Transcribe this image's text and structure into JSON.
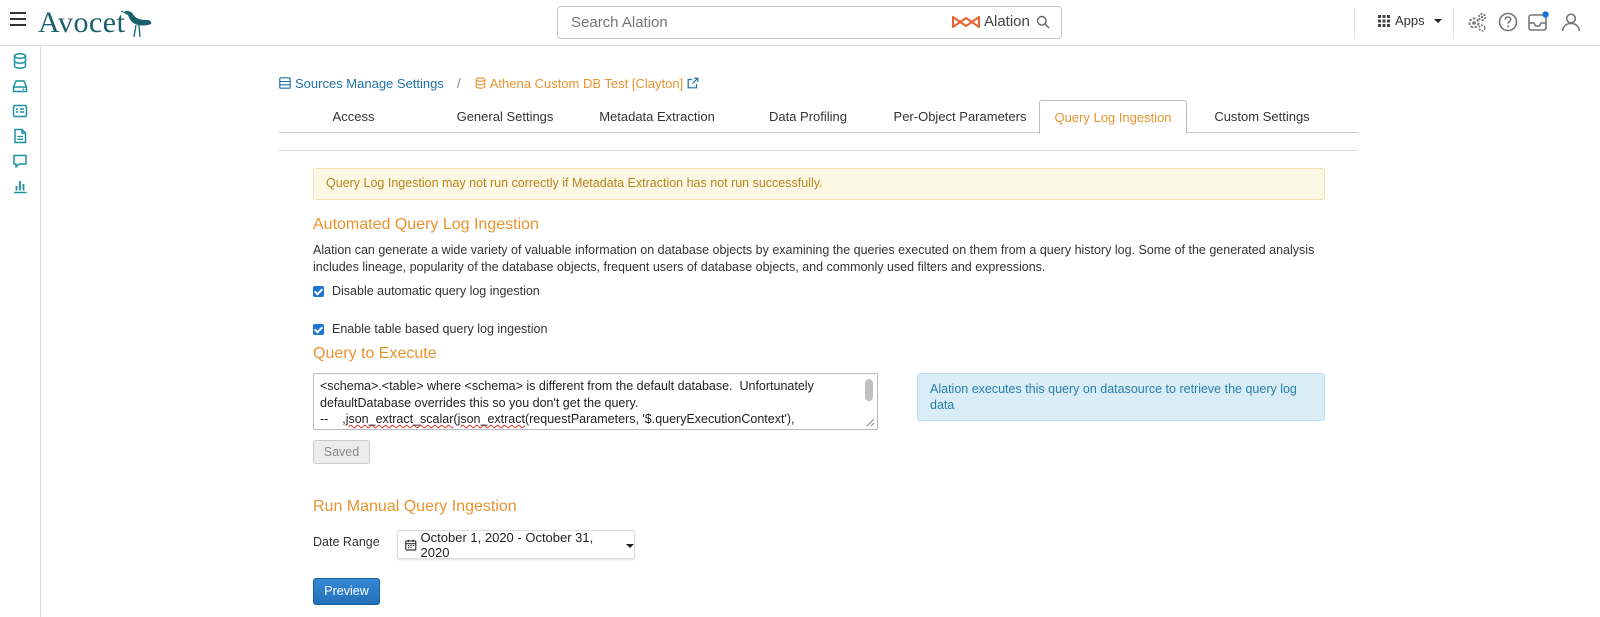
{
  "header": {
    "logo_text": "Avocet",
    "search": {
      "placeholder": "Search Alation",
      "brand_label": "Alation"
    },
    "apps_label": "Apps"
  },
  "left_rail": {
    "items": [
      "database-icon",
      "storage-icon",
      "catalog-icon",
      "document-icon",
      "conversation-icon",
      "chart-icon"
    ]
  },
  "breadcrumb": {
    "parent": "Sources Manage Settings",
    "separator": "/",
    "current": "Athena Custom DB Test [Clayton]"
  },
  "tabs": [
    {
      "label": "Access"
    },
    {
      "label": "General Settings"
    },
    {
      "label": "Metadata Extraction"
    },
    {
      "label": "Data Profiling"
    },
    {
      "label": "Per-Object Parameters"
    },
    {
      "label": "Query Log Ingestion",
      "active": true
    },
    {
      "label": "Custom Settings"
    }
  ],
  "content": {
    "warning": "Query Log Ingestion may not run correctly if Metadata Extraction has not run successfully.",
    "auto_heading": "Automated Query Log Ingestion",
    "auto_description": "Alation can generate a wide variety of valuable information on database objects by examining the queries executed on them from a query history log. Some of the generated analysis includes lineage, popularity of the database objects, frequent users of database objects, and commonly used filters and expressions.",
    "checkbox_disable": {
      "label": "Disable automatic query log ingestion",
      "checked": true
    },
    "checkbox_table": {
      "label": "Enable table based query log ingestion",
      "checked": true
    },
    "query_heading": "Query to Execute",
    "query_lines": {
      "line1": "<schema>.<table> where <schema> is different from the default database.  Unfortunately",
      "line2": "defaultDatabase overrides this so you don't get the query.",
      "line3_prefix": "--    ,",
      "line3_squig1": "json_extract_scalar",
      "line3_mid": "(",
      "line3_squig2": "json_extract",
      "line3_suffix": "(requestParameters, '$.queryExecutionContext'),"
    },
    "query_info": "Alation executes this query on datasource to retrieve the query log data",
    "saved_button": "Saved",
    "manual_heading": "Run Manual Query Ingestion",
    "date_range_label": "Date Range",
    "date_range_value": "October 1, 2020 - October 31, 2020",
    "preview_button": "Preview"
  },
  "colors": {
    "accent_orange": "#e8932e",
    "link_blue": "#1f72a6",
    "logo_teal": "#1a5f6e",
    "primary_button": "#2a7ac4"
  }
}
